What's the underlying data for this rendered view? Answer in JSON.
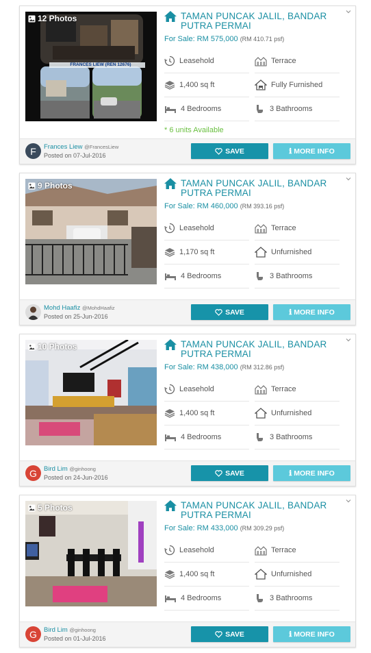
{
  "colors": {
    "primary": "#1a8fa3",
    "save_button": "#1793a9",
    "more_button": "#5cc9db",
    "units_green": "#6abf40"
  },
  "listings": [
    {
      "photo_count": "12 Photos",
      "title": "TAMAN PUNCAK JALIL, BANDAR PUTRA PERMAI",
      "price_label": "For Sale: RM 575,000",
      "price_psf": "(RM 410.71 psf)",
      "tenure": "Leasehold",
      "property_type": "Terrace",
      "size": "1,400 sq ft",
      "furnishing": "Fully Furnished",
      "bedrooms": "4 Bedrooms",
      "bathrooms": "3 Bathrooms",
      "units_available": "* 6 units Available",
      "agent_name": "Frances Liew",
      "agent_handle": "@FrancesLiew",
      "avatar_letter": "F",
      "avatar_color": "#3a4a5c",
      "posted": "Posted on 07-Jul-2016",
      "photo_overlay_text": "FRANCES LIEW (REN 12676)",
      "save_label": "SAVE",
      "more_label": "MORE INFO"
    },
    {
      "photo_count": "9 Photos",
      "title": "TAMAN PUNCAK JALIL, BANDAR PUTRA PERMAI",
      "price_label": "For Sale: RM 460,000",
      "price_psf": "(RM 393.16 psf)",
      "tenure": "Leasehold",
      "property_type": "Terrace",
      "size": "1,170 sq ft",
      "furnishing": "Unfurnished",
      "bedrooms": "4 Bedrooms",
      "bathrooms": "3 Bathrooms",
      "agent_name": "Mohd Haafiz",
      "agent_handle": "@MohdHaafiz",
      "avatar_letter": "",
      "avatar_color": "#5a4a3c",
      "posted": "Posted on 25-Jun-2016",
      "save_label": "SAVE",
      "more_label": "MORE INFO"
    },
    {
      "photo_count": "10 Photos",
      "title": "TAMAN PUNCAK JALIL, BANDAR PUTRA PERMAI",
      "price_label": "For Sale: RM 438,000",
      "price_psf": "(RM 312.86 psf)",
      "tenure": "Leasehold",
      "property_type": "Terrace",
      "size": "1,400 sq ft",
      "furnishing": "Unfurnished",
      "bedrooms": "4 Bedrooms",
      "bathrooms": "3 Bathrooms",
      "agent_name": "Bird Lim",
      "agent_handle": "@ginhoong",
      "avatar_letter": "G",
      "avatar_color": "#d84436",
      "posted": "Posted on 24-Jun-2016",
      "save_label": "SAVE",
      "more_label": "MORE INFO"
    },
    {
      "photo_count": "5 Photos",
      "title": "TAMAN PUNCAK JALIL, BANDAR PUTRA PERMAI",
      "price_label": "For Sale: RM 433,000",
      "price_psf": "(RM 309.29 psf)",
      "tenure": "Leasehold",
      "property_type": "Terrace",
      "size": "1,400 sq ft",
      "furnishing": "Unfurnished",
      "bedrooms": "4 Bedrooms",
      "bathrooms": "3 Bathrooms",
      "agent_name": "Bird Lim",
      "agent_handle": "@ginhoong",
      "avatar_letter": "G",
      "avatar_color": "#d84436",
      "posted": "Posted on 01-Jul-2016",
      "save_label": "SAVE",
      "more_label": "MORE INFO"
    }
  ]
}
